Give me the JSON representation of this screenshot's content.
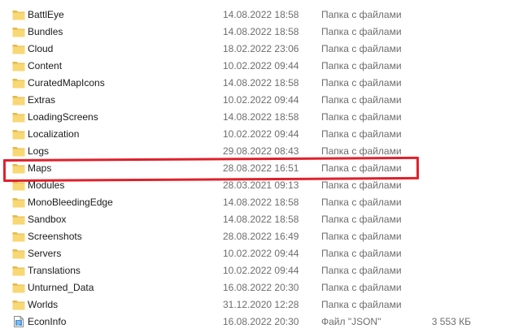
{
  "rows": [
    {
      "name": "BattlEye",
      "date": "14.08.2022 18:58",
      "type": "Папка с файлами",
      "size": "",
      "icon": "folder-icon"
    },
    {
      "name": "Bundles",
      "date": "14.08.2022 18:58",
      "type": "Папка с файлами",
      "size": "",
      "icon": "folder-icon"
    },
    {
      "name": "Cloud",
      "date": "18.02.2022 23:06",
      "type": "Папка с файлами",
      "size": "",
      "icon": "folder-icon"
    },
    {
      "name": "Content",
      "date": "10.02.2022 09:44",
      "type": "Папка с файлами",
      "size": "",
      "icon": "folder-icon"
    },
    {
      "name": "CuratedMapIcons",
      "date": "14.08.2022 18:58",
      "type": "Папка с файлами",
      "size": "",
      "icon": "folder-icon"
    },
    {
      "name": "Extras",
      "date": "10.02.2022 09:44",
      "type": "Папка с файлами",
      "size": "",
      "icon": "folder-icon"
    },
    {
      "name": "LoadingScreens",
      "date": "14.08.2022 18:58",
      "type": "Папка с файлами",
      "size": "",
      "icon": "folder-icon"
    },
    {
      "name": "Localization",
      "date": "10.02.2022 09:44",
      "type": "Папка с файлами",
      "size": "",
      "icon": "folder-icon"
    },
    {
      "name": "Logs",
      "date": "29.08.2022 08:43",
      "type": "Папка с файлами",
      "size": "",
      "icon": "folder-icon"
    },
    {
      "name": "Maps",
      "date": "28.08.2022 16:51",
      "type": "Папка с файлами",
      "size": "",
      "icon": "folder-icon"
    },
    {
      "name": "Modules",
      "date": "28.03.2021 09:13",
      "type": "Папка с файлами",
      "size": "",
      "icon": "folder-icon"
    },
    {
      "name": "MonoBleedingEdge",
      "date": "14.08.2022 18:58",
      "type": "Папка с файлами",
      "size": "",
      "icon": "folder-icon"
    },
    {
      "name": "Sandbox",
      "date": "14.08.2022 18:58",
      "type": "Папка с файлами",
      "size": "",
      "icon": "folder-icon"
    },
    {
      "name": "Screenshots",
      "date": "28.08.2022 16:49",
      "type": "Папка с файлами",
      "size": "",
      "icon": "folder-icon"
    },
    {
      "name": "Servers",
      "date": "10.02.2022 09:44",
      "type": "Папка с файлами",
      "size": "",
      "icon": "folder-icon"
    },
    {
      "name": "Translations",
      "date": "10.02.2022 09:44",
      "type": "Папка с файлами",
      "size": "",
      "icon": "folder-icon"
    },
    {
      "name": "Unturned_Data",
      "date": "16.08.2022 20:30",
      "type": "Папка с файлами",
      "size": "",
      "icon": "folder-icon"
    },
    {
      "name": "Worlds",
      "date": "31.12.2020 12:28",
      "type": "Папка с файлами",
      "size": "",
      "icon": "folder-icon"
    },
    {
      "name": "EconInfo",
      "date": "16.08.2022 20:30",
      "type": "Файл \"JSON\"",
      "size": "3 553 КБ",
      "icon": "json-file-icon"
    }
  ],
  "highlighted_row": "Maps",
  "colors": {
    "folder": "#f8d775",
    "folder_dark": "#e4b94a",
    "highlight": "#e0202b",
    "meta_text": "#6d6d6d"
  }
}
